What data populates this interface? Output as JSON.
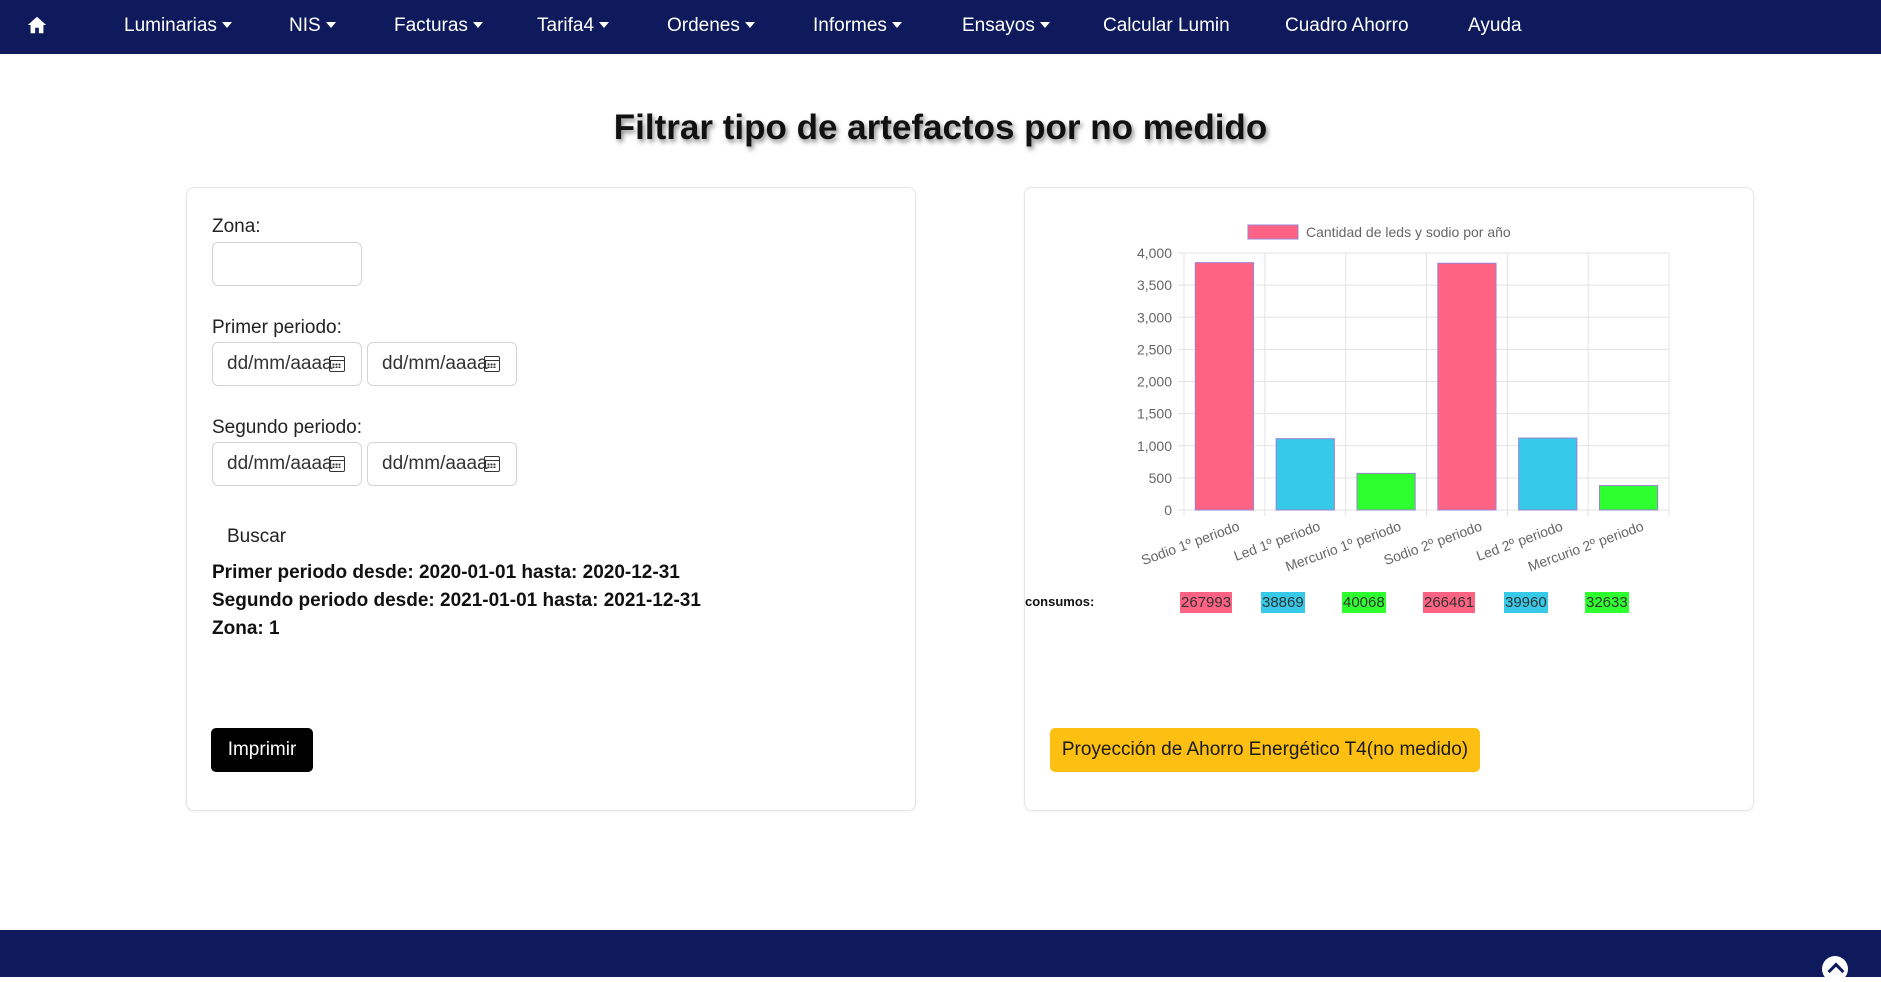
{
  "nav": {
    "home_icon": "home-icon",
    "items": [
      {
        "label": "Luminarias",
        "dropdown": true
      },
      {
        "label": "NIS",
        "dropdown": true
      },
      {
        "label": "Facturas",
        "dropdown": true
      },
      {
        "label": "Tarifa4",
        "dropdown": true
      },
      {
        "label": "Ordenes",
        "dropdown": true
      },
      {
        "label": "Informes",
        "dropdown": true
      },
      {
        "label": "Ensayos",
        "dropdown": true
      },
      {
        "label": "Calcular Lumin",
        "dropdown": false
      },
      {
        "label": "Cuadro Ahorro",
        "dropdown": false
      },
      {
        "label": "Ayuda",
        "dropdown": false
      }
    ]
  },
  "page_title": "Filtrar tipo de artefactos por no medido",
  "form": {
    "zona_label": "Zona:",
    "zona_value": "",
    "primer_label": "Primer periodo:",
    "segundo_label": "Segundo periodo:",
    "date_placeholder": "dd/mm/aaaa",
    "buscar_label": "Buscar",
    "primer_info": "Primer periodo desde: 2020-01-01 hasta: 2020-12-31",
    "segundo_info": "Segundo periodo desde: 2021-01-01 hasta: 2021-12-31",
    "zona_info": "Zona: 1",
    "imprimir_label": "Imprimir"
  },
  "chart_data": {
    "type": "bar",
    "legend": "Cantidad de leds y sodio por año",
    "legend_position": "top",
    "categories": [
      "Sodio 1º periodo",
      "Led 1º periodo",
      "Mercurio 1º periodo",
      "Sodio 2º periodo",
      "Led 2º periodo",
      "Mercurio 2º periodo"
    ],
    "values": [
      3850,
      1110,
      570,
      3840,
      1120,
      380
    ],
    "colors": [
      "#ff6384",
      "#36c9e8",
      "#2eff2e",
      "#ff6384",
      "#36c9e8",
      "#2eff2e"
    ],
    "ylim": [
      0,
      4000
    ],
    "yticks": [
      "0",
      "500",
      "1,000",
      "1,500",
      "2,000",
      "2,500",
      "3,000",
      "3,500",
      "4,000"
    ],
    "grid": true
  },
  "consumos": {
    "label": "consumos:",
    "values": [
      "267993",
      "38869",
      "40068",
      "266461",
      "39960",
      "32633"
    ]
  },
  "proyeccion_label": "Proyección de Ahorro Energético T4(no medido)"
}
